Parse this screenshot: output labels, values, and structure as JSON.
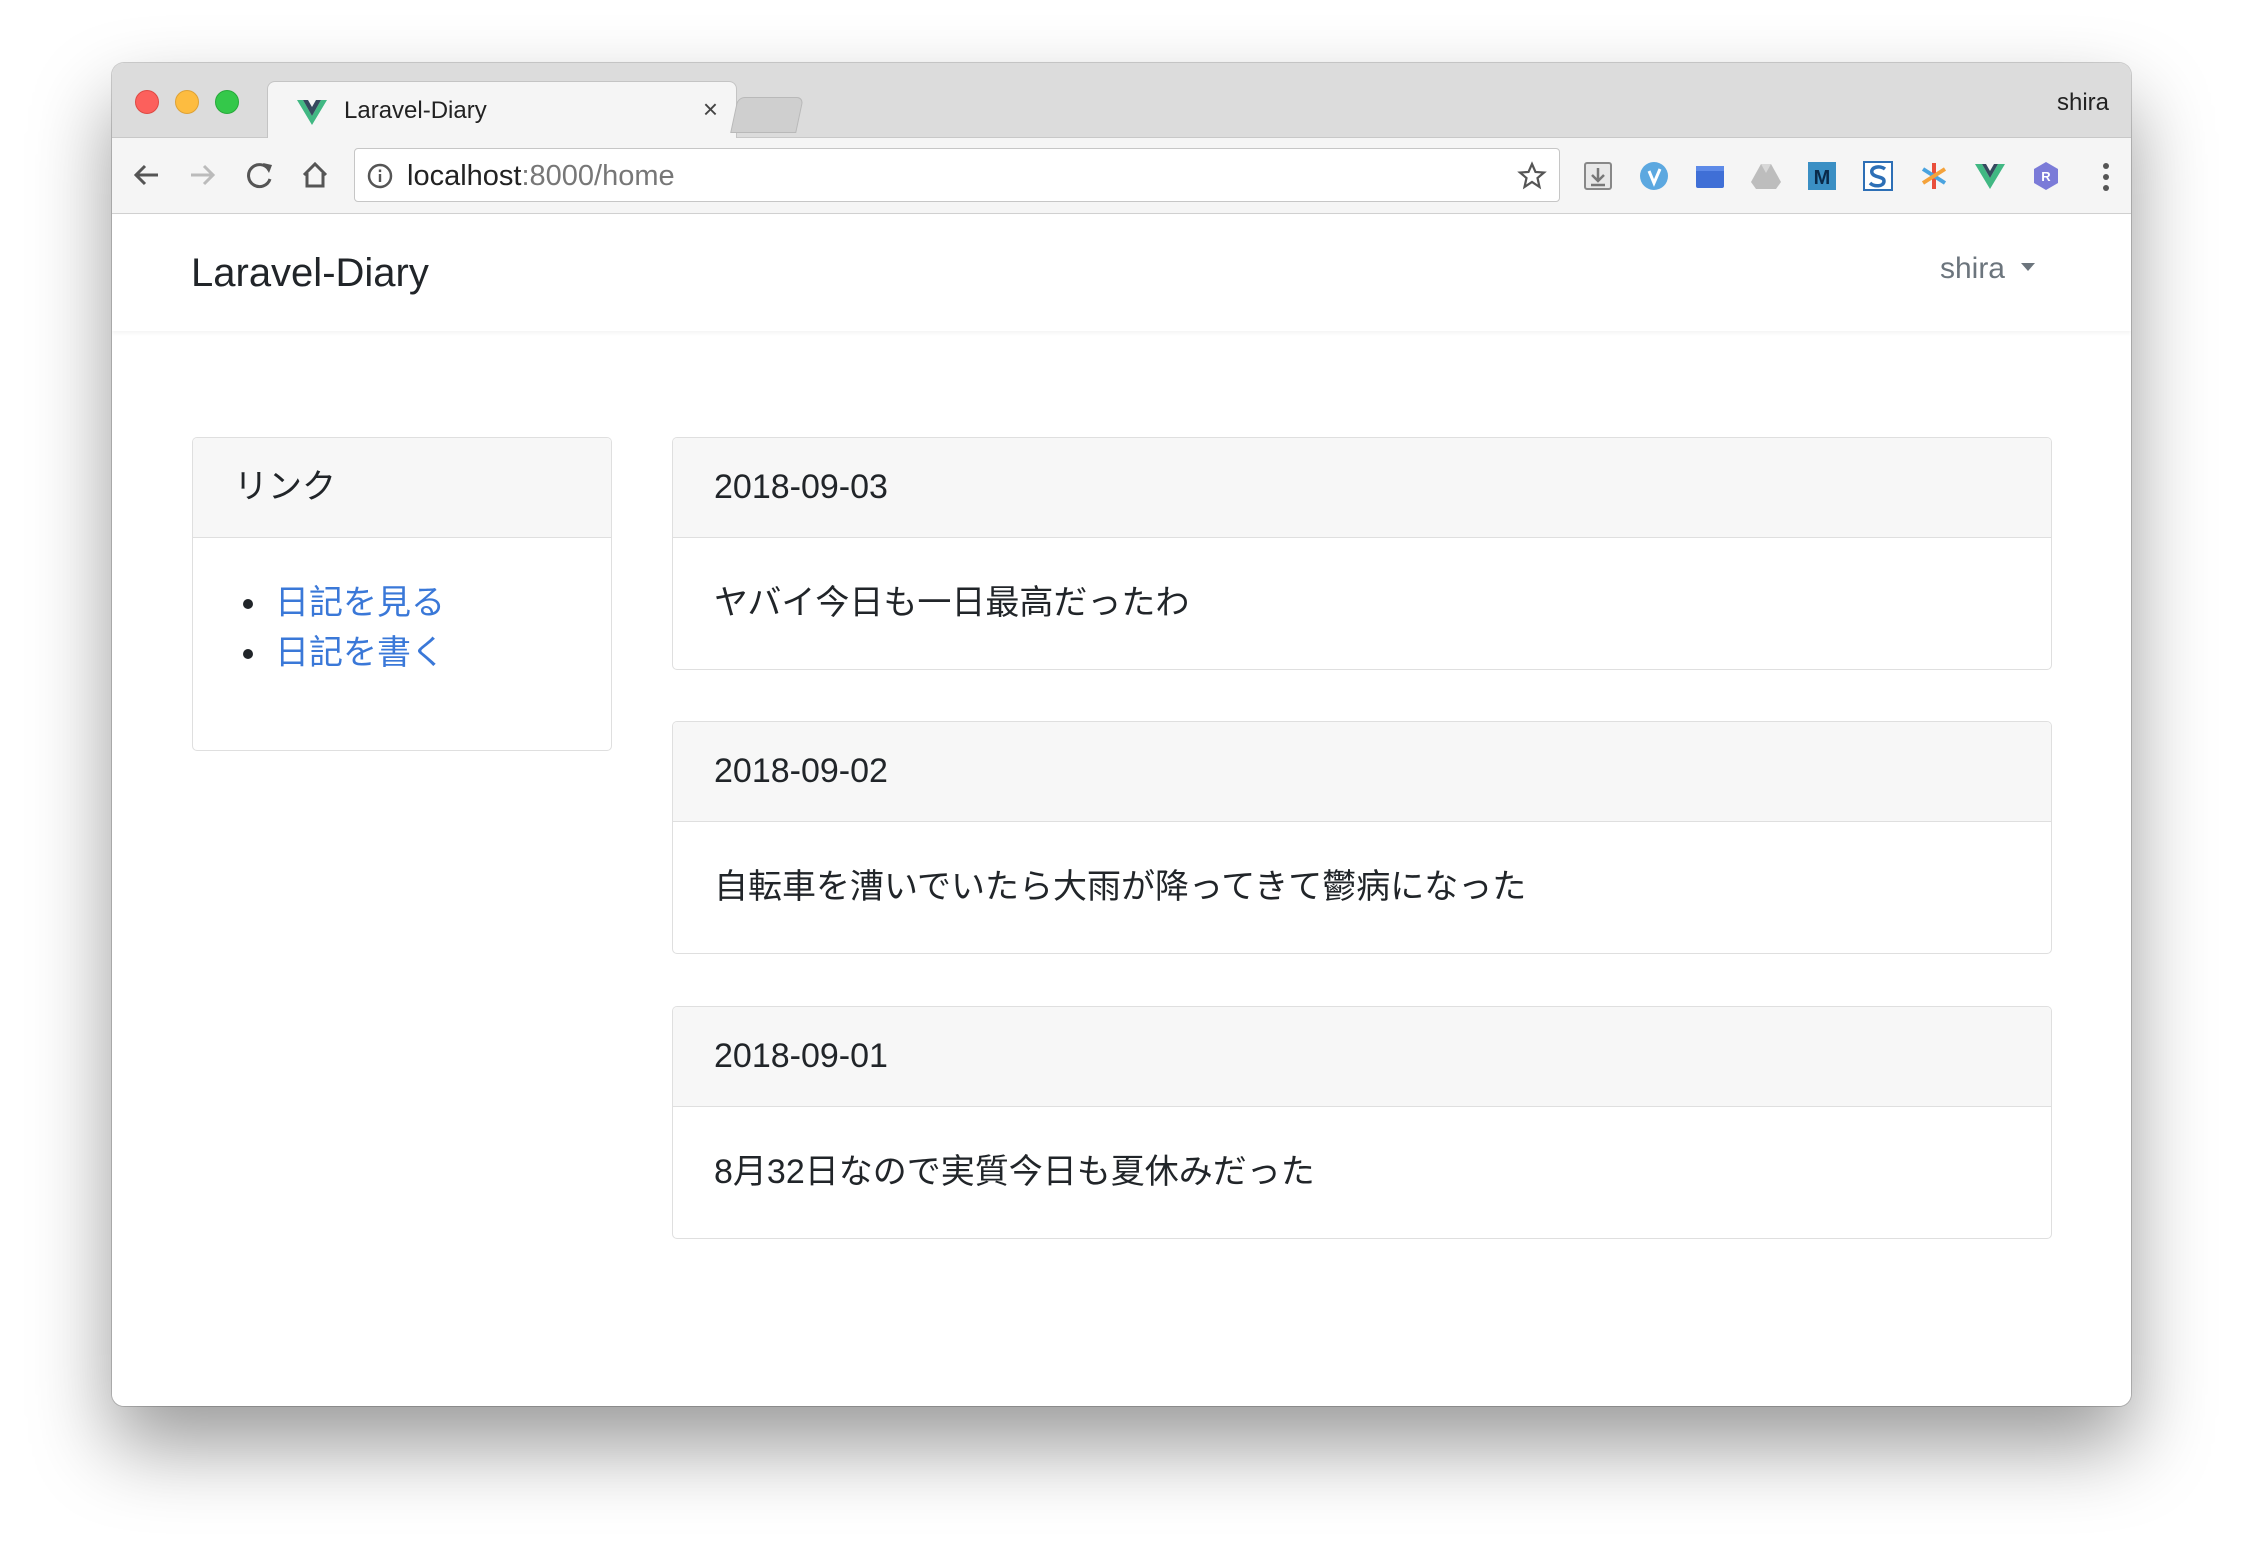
{
  "browser": {
    "tab_title": "Laravel-Diary",
    "tab_close": "×",
    "profile_name": "shira",
    "url_host": "localhost",
    "url_rest": ":8000/home",
    "extensions": [
      "download-icon",
      "vimium-icon",
      "folder-icon",
      "drive-icon",
      "m-icon",
      "s-icon",
      "asterisk-icon",
      "vue-devtools-icon",
      "r-icon"
    ]
  },
  "navbar": {
    "brand": "Laravel-Diary",
    "user": "shira"
  },
  "sidebar": {
    "title": "リンク",
    "links": [
      {
        "label": "日記を見る"
      },
      {
        "label": "日記を書く"
      }
    ]
  },
  "entries": [
    {
      "date": "2018-09-03",
      "text": "ヤバイ今日も一日最高だったわ"
    },
    {
      "date": "2018-09-02",
      "text": "自転車を漕いでいたら大雨が降ってきて鬱病になった"
    },
    {
      "date": "2018-09-01",
      "text": "8月32日なので実質今日も夏休みだった"
    }
  ],
  "colors": {
    "link": "#3a78d8",
    "card_header_bg": "#f7f7f7",
    "text": "#212529",
    "muted": "#6c757d"
  }
}
